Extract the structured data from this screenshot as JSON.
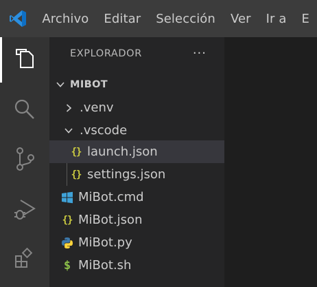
{
  "menu": {
    "items": [
      "Archivo",
      "Editar",
      "Selección",
      "Ver",
      "Ir a",
      "E"
    ]
  },
  "activity_bar": {
    "items": [
      {
        "icon": "explorer-icon",
        "active": true
      },
      {
        "icon": "search-icon",
        "active": false
      },
      {
        "icon": "source-control-icon",
        "active": false
      },
      {
        "icon": "run-debug-icon",
        "active": false
      },
      {
        "icon": "extensions-icon",
        "active": false
      }
    ]
  },
  "sidebar": {
    "title": "EXPLORADOR",
    "more": "···",
    "root": {
      "label": "MIBOT",
      "expanded": true
    },
    "tree": [
      {
        "label": ".venv",
        "type": "folder",
        "expanded": false
      },
      {
        "label": ".vscode",
        "type": "folder",
        "expanded": true
      },
      {
        "label": "launch.json",
        "type": "json",
        "selected": true
      },
      {
        "label": "settings.json",
        "type": "json"
      },
      {
        "label": "MiBot.cmd",
        "type": "cmd"
      },
      {
        "label": "MiBot.json",
        "type": "json"
      },
      {
        "label": "MiBot.py",
        "type": "python"
      },
      {
        "label": "MiBot.sh",
        "type": "shell"
      }
    ]
  },
  "colors": {
    "accent": "#0078d4",
    "json_icon": "#cbcb41",
    "python_icon": "#3c78aa",
    "cmd_icon": "#3fa2d8",
    "shell_icon": "#8dc149",
    "selected_row": "#37373d"
  }
}
